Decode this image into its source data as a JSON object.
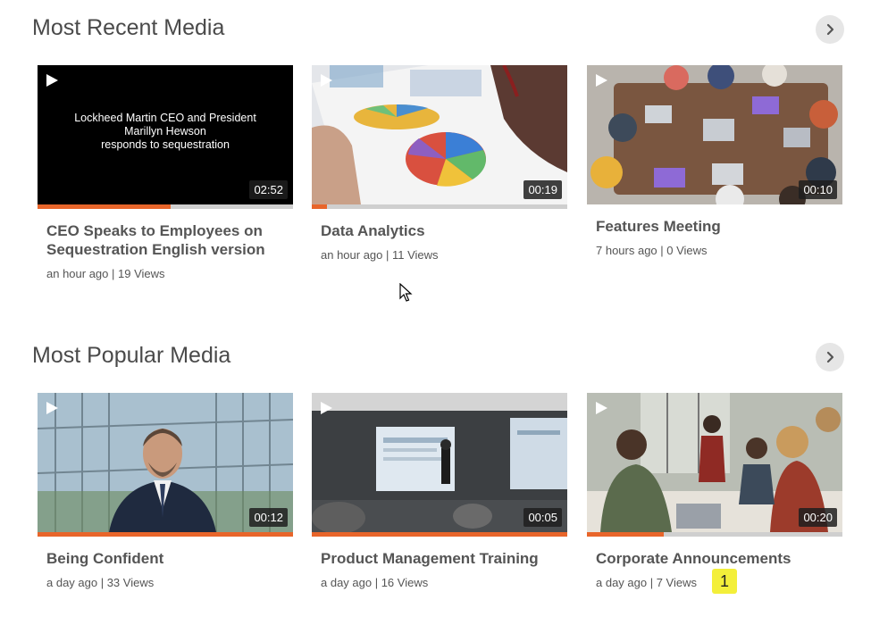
{
  "sections": [
    {
      "title": "Most Recent Media",
      "items": [
        {
          "title_line1": "CEO Speaks to Employees on",
          "title_line2": "Sequestration English version",
          "meta": "an hour ago | 19 Views",
          "duration": "02:52",
          "progress": 0.52,
          "overlay": {
            "line1": "Lockheed Martin CEO and President",
            "line2": "Marillyn Hewson",
            "line3": "responds to sequestration"
          }
        },
        {
          "title_line1": "Data Analytics",
          "title_line2": "",
          "meta": "an hour ago | 11 Views",
          "duration": "00:19",
          "progress": 0.06
        },
        {
          "title_line1": "Features Meeting",
          "title_line2": "",
          "meta": "7 hours ago | 0 Views",
          "duration": "00:10",
          "progress": 0
        }
      ]
    },
    {
      "title": "Most Popular Media",
      "items": [
        {
          "title_line1": "Being Confident",
          "title_line2": "",
          "meta": "a day ago | 33 Views",
          "duration": "00:12",
          "progress": 1.0
        },
        {
          "title_line1": "Product Management Training",
          "title_line2": "",
          "meta": "a day ago | 16 Views",
          "duration": "00:05",
          "progress": 1.0
        },
        {
          "title_line1": "Corporate Announcements",
          "title_line2": "",
          "meta": "a day ago | 7 Views",
          "duration": "00:20",
          "progress": 0.3
        }
      ]
    }
  ],
  "annotation_badge": "1",
  "icons": {
    "play": "play-icon",
    "next": "chevron-right-icon",
    "cursor": "mouse-cursor-icon"
  },
  "colors": {
    "accent": "#e8652a",
    "badge": "#f3ef3a"
  }
}
